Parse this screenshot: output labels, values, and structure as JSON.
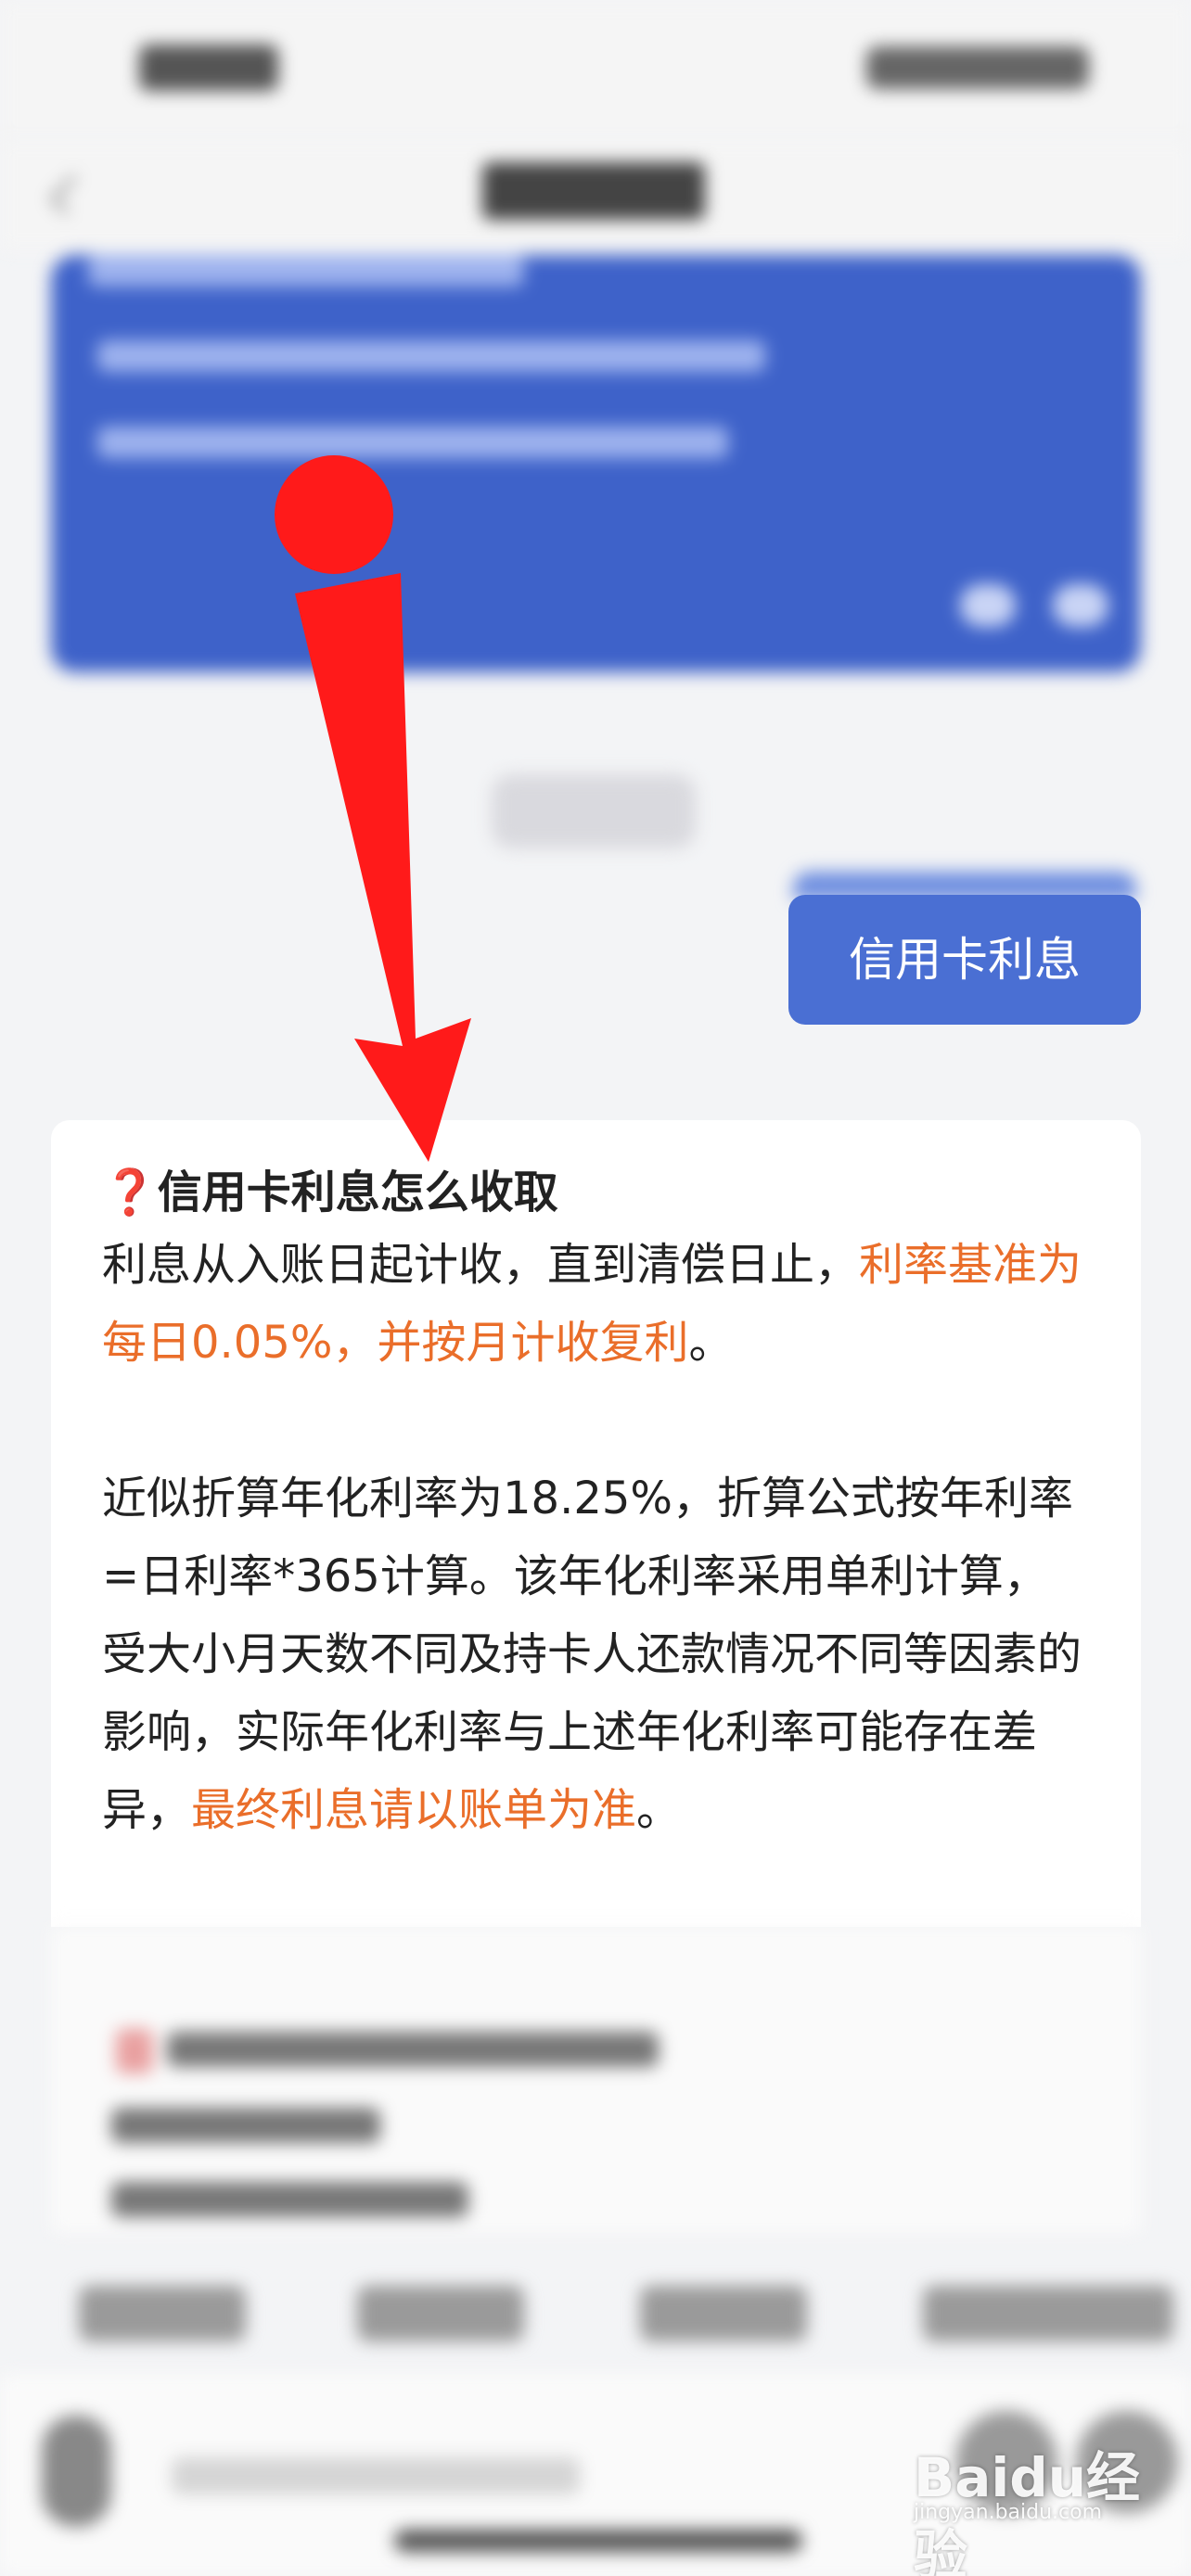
{
  "user_message": {
    "text": "信用卡利息"
  },
  "answer": {
    "title_icon": "question-mark-icon",
    "title_icon_glyph": "❓",
    "title": "信用卡利息怎么收取",
    "p1_text": "利息从入账日起计收，直到清偿日止，",
    "p1_highlight": "利率基准为每日0.05%，并按月计收复利",
    "p1_end": "。",
    "p2_text": "近似折算年化利率为18.25%，折算公式按年利率=日利率*365计算。该年化利率采用单利计算，受大小月天数不同及持卡人还款情况不同等因素的影响，实际年化利率与上述年化利率可能存在差异，",
    "p2_highlight": "最终利息请以账单为准",
    "p2_end": "。"
  },
  "colors": {
    "accent_blue": "#4a6fd3",
    "highlight_orange": "#ea6e2a",
    "annotation_red": "#ff1a1a"
  },
  "watermark": {
    "brand": "Baidu经验",
    "site": "jingyan.baidu.com"
  }
}
